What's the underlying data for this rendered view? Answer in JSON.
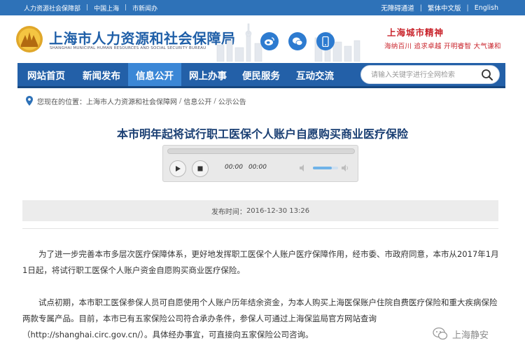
{
  "topbar": {
    "left_links": [
      "人力资源社会保障部",
      "中国上海",
      "市新闻办"
    ],
    "right_links": [
      "无障碍通道",
      "繁体中文版",
      "English"
    ]
  },
  "header": {
    "title": "上海市人力资源和社会保障局",
    "subtitle": "SHANGHAI MUNICIPAL HUMAN RESOURCES AND SOCIAL SECURITY BUREAU",
    "social_icons": [
      "weibo-icon",
      "wechat-icon",
      "mobile-icon"
    ],
    "spirit_title": "上海城市精神",
    "spirit_text": "海纳百川  追求卓越  开明睿智  大气谦和"
  },
  "nav": {
    "items": [
      "网站首页",
      "新闻发布",
      "信息公开",
      "网上办事",
      "便民服务",
      "互动交流"
    ],
    "active_index": 2,
    "search_placeholder": "请输入关键字进行全网检索"
  },
  "breadcrumb": {
    "label": "您现在的位置：",
    "items": [
      "上海市人力资源和社会保障网",
      "信息公开",
      "公示公告"
    ],
    "separator": "/"
  },
  "article": {
    "title": "本市明年起将试行职工医保个人账户自愿购买商业医疗保险",
    "player": {
      "current_time": "00:00",
      "duration": "00:00",
      "volume_level": 0.75
    },
    "publish_label": "发布时间：",
    "publish_time": "2016-12-30 13:26",
    "paragraphs": [
      "为了进一步完善本市多层次医疗保障体系，更好地发挥职工医保个人账户医疗保障作用，经市委、市政府同意，本市从2017年1月1日起，将试行职工医保个人账户资金自愿购买商业医疗保险。",
      "试点初期，本市职工医保参保人员可自愿使用个人账户历年结余资金，为本人购买上海医保账户住院自费医疗保险和重大疾病保险两款专属产品。目前，本市已有五家保险公司符合承办条件，参保人可通过上海保监局官方网站查询"
    ],
    "para3_prefix": "（",
    "para3_link": "http://shanghai.circ.gov.cn/",
    "para3_suffix": "）。具体经办事宜，可直接向五家保险公司咨询。"
  },
  "watermark": {
    "text": "上海静安"
  },
  "colors": {
    "topbar": "#2e72b8",
    "nav": "#2360a8",
    "nav_active": "#3b87d6",
    "title_blue": "#1a3f73",
    "spirit_red": "#c9232b"
  }
}
